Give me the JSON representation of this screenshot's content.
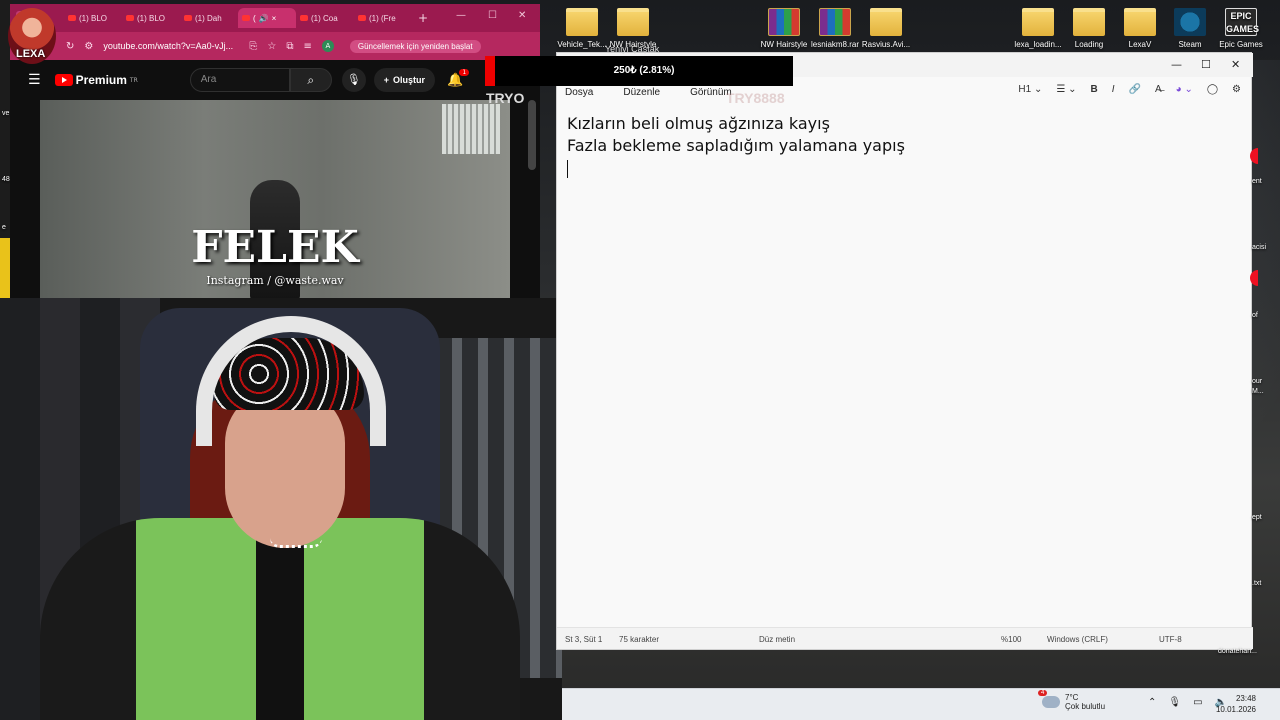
{
  "desktop_icons": [
    {
      "label": "Vehicle_Tek...",
      "type": "folder"
    },
    {
      "label": "NW Hairstyle",
      "type": "folder"
    },
    {
      "label": "NW Hairstyle",
      "type": "rar"
    },
    {
      "label": "lesniakm8.rar",
      "type": "rar"
    },
    {
      "label": "Rasvius.Avi...",
      "type": "folder"
    },
    {
      "label": "lexa_loadin...",
      "type": "folder"
    },
    {
      "label": "Loading",
      "type": "folder"
    },
    {
      "label": "LexaV",
      "type": "folder"
    },
    {
      "label": "Steam",
      "type": "steam"
    },
    {
      "label": "Epic Games",
      "type": "epic"
    }
  ],
  "epic_logo_text": "EPIC GAMES",
  "browser": {
    "tabs": [
      {
        "label": "(1) BLO"
      },
      {
        "label": "(1) BLO"
      },
      {
        "label": "(1) Dah"
      },
      {
        "label": "(",
        "active": true
      },
      {
        "label": "(1) Coa"
      },
      {
        "label": "(1) (Fre"
      }
    ],
    "new_tab": "+",
    "url": "youtube.com/watch?v=Aa0-vJj...",
    "update_label": "Güncellemek için yeniden başlat",
    "profile_initial": "A",
    "overlay_logo": "LEXA"
  },
  "youtube": {
    "brand": "Premium",
    "region": "TR",
    "search_placeholder": "Ara",
    "create_label": "Oluştur",
    "notif_count": "1",
    "video_title": "FELEK",
    "video_subtitle": "Instagram / @waste.wav"
  },
  "overlay": {
    "donation_text": "250₺ (2.81%)",
    "channel_tag": "TRYO",
    "partial_label": "Yeniyi Çaştak",
    "watermark": "TRY8888"
  },
  "notepad": {
    "menu": [
      "Dosya",
      "Düzenle",
      "Görünüm"
    ],
    "heading_select": "H1",
    "lines": [
      "Kızların beli olmuş ağzınıza kayış",
      "Fazla bekleme sapladığım yalamana yapış"
    ],
    "status": {
      "position": "St 3, Süt 1",
      "chars": "75 karakter",
      "mode": "Düz metin",
      "zoom": "%100",
      "line_ending": "Windows (CRLF)",
      "encoding": "UTF-8"
    }
  },
  "right_edge_labels": [
    "ent",
    "acisi",
    "of",
    "our",
    "M...",
    "ept",
    ".txt",
    "donatehan..."
  ],
  "left_edge_labels": [
    "ve",
    "48",
    "e"
  ],
  "taskbar": {
    "weather_badge": "4",
    "temperature": "7°C",
    "condition": "Çok bulutlu",
    "time": "23:48",
    "date": "10.01.2026"
  },
  "colors": {
    "browser_tab_bar": "#9b1a4f",
    "browser_address_bar": "#b5285f",
    "youtube_red": "#ff0000",
    "donation_accent": "#ee0000"
  }
}
